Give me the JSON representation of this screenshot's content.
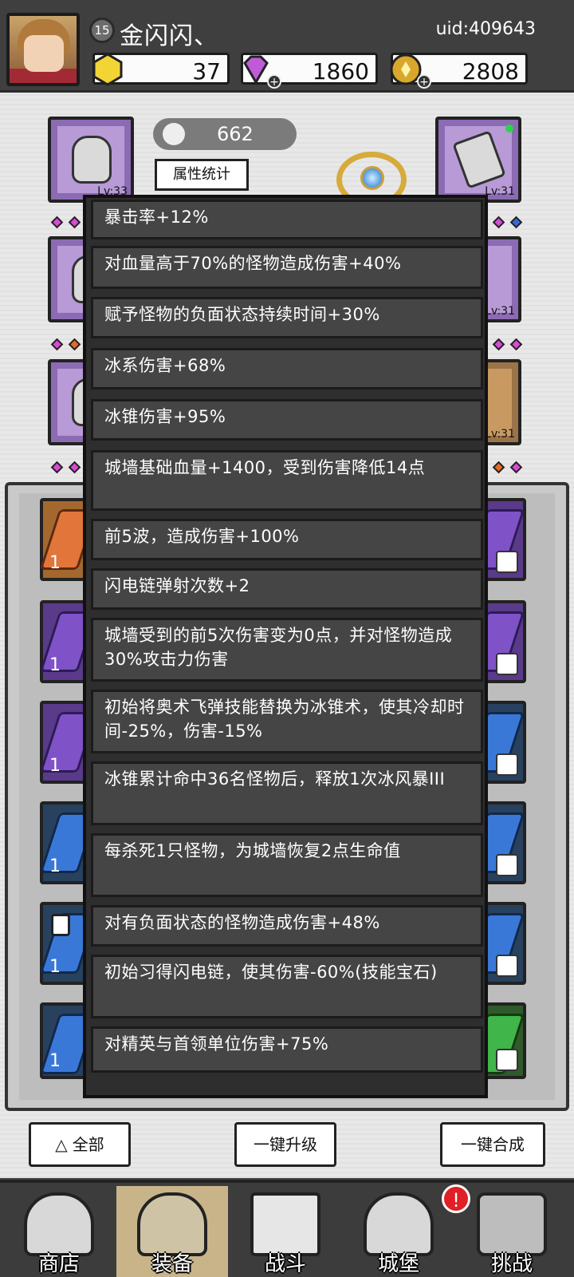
{
  "player": {
    "level": "15",
    "name": "金闪闪、",
    "uid": "uid:409643"
  },
  "resources": {
    "gold": "37",
    "gems": "1860",
    "coins": "2808"
  },
  "hero": {
    "power": "662",
    "stat_button": "属性统计"
  },
  "equipment_slots": {
    "top_left_lv": "Lv:33",
    "top_right_lv": "Lv:31",
    "mid_right_lv": "Lv:31",
    "low_right_lv": "Lv:31"
  },
  "tooltip_lines": [
    "暴击率+12%",
    "对血量高于70%的怪物造成伤害+40%",
    "赋予怪物的负面状态持续时间+30%",
    "冰系伤害+68%",
    "冰锥伤害+95%",
    "城墙基础血量+1400，受到伤害降低14点",
    "前5波，造成伤害+100%",
    "闪电链弹射次数+2",
    "城墙受到的前5次伤害变为0点，并对怪物造成30%攻击力伤害",
    "初始将奥术飞弹技能替换为冰锥术，使其冷却时间-25%，伤害-15%",
    "冰锥累计命中36名怪物后，释放1次冰风暴III",
    "每杀死1只怪物，为城墙恢复2点生命值",
    "对有负面状态的怪物造成伤害+48%",
    "初始习得闪电链，使其伤害-60%(技能宝石)",
    "对精英与首领单位伤害+75%"
  ],
  "inventory_counts": [
    "1",
    "1",
    "1",
    "1",
    "1",
    "1"
  ],
  "actions": {
    "filter": "全部",
    "upgrade_all": "一键升级",
    "merge_all": "一键合成"
  },
  "nav": {
    "shop": "商店",
    "equip": "装备",
    "battle": "战斗",
    "castle": "城堡",
    "challenge": "挑战",
    "alert": "!"
  },
  "colors": {
    "purple_slot": "#8b6bb3",
    "orange_slot": "#9a7448",
    "alert_red": "#e01f26"
  }
}
